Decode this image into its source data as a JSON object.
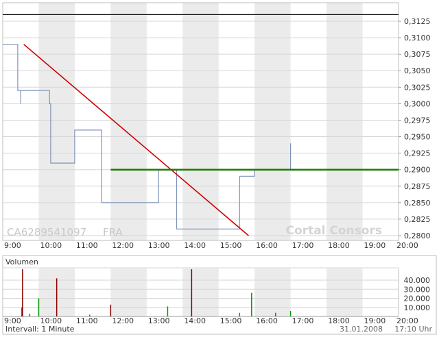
{
  "chart_data": [
    {
      "type": "line",
      "panel": "price",
      "source_id": "CA6289541097",
      "exchange": "FRA",
      "watermark": "Cortal Consors",
      "x_ticks": [
        "9:00",
        "10:00",
        "11:00",
        "12:00",
        "13:00",
        "14:00",
        "15:00",
        "16:00",
        "17:00",
        "18:00",
        "19:00",
        "20:00"
      ],
      "y_ticks": [
        "0,3125",
        "0,3100",
        "0,3075",
        "0,3050",
        "0,3025",
        "0,3000",
        "0,2975",
        "0,2950",
        "0,2925",
        "0,2900",
        "0,2875",
        "0,2850",
        "0,2825",
        "0,2800"
      ],
      "ylim": [
        0.28,
        0.3138
      ],
      "xlim": [
        "09:00",
        "20:00"
      ],
      "grid": "vertical alternating bands + horizontal lines",
      "series": [
        {
          "color": "#7f93b8",
          "style": "step",
          "points": [
            [
              "09:00",
              0.309
            ],
            [
              "09:25",
              0.309
            ],
            [
              "09:25",
              0.302
            ],
            [
              "09:30",
              0.302
            ],
            [
              "09:30",
              0.3
            ],
            [
              "09:30",
              0.302
            ],
            [
              "10:18",
              0.302
            ],
            [
              "10:18",
              0.3
            ],
            [
              "10:20",
              0.3
            ],
            [
              "10:20",
              0.291
            ],
            [
              "11:00",
              0.291
            ],
            [
              "11:00",
              0.296
            ],
            [
              "11:45",
              0.296
            ],
            [
              "11:45",
              0.285
            ],
            [
              "13:20",
              0.285
            ],
            [
              "13:20",
              0.29
            ],
            [
              "13:50",
              0.29
            ],
            [
              "13:50",
              0.281
            ],
            [
              "15:35",
              0.281
            ],
            [
              "15:35",
              0.289
            ],
            [
              "16:00",
              0.289
            ],
            [
              "16:00",
              0.29
            ],
            [
              "17:00",
              0.29
            ],
            [
              "17:00",
              0.294
            ],
            [
              "17:00",
              0.29
            ]
          ]
        },
        {
          "color": "#cc0000",
          "style": "trendline",
          "points": [
            [
              "09:35",
              0.309
            ],
            [
              "15:50",
              0.28
            ]
          ]
        },
        {
          "color": "#1e7a00",
          "style": "trendline",
          "points": [
            [
              "12:00",
              0.29
            ],
            [
              "20:00",
              0.29
            ]
          ]
        },
        {
          "color": "#000000",
          "style": "line",
          "points": [
            [
              "09:00",
              0.3135
            ],
            [
              "20:00",
              0.3135
            ]
          ]
        }
      ]
    },
    {
      "type": "bar",
      "panel": "volume",
      "title": "Volumen",
      "x_ticks": [
        "9:00",
        "10:00",
        "11:00",
        "12:00",
        "13:00",
        "14:00",
        "15:00",
        "16:00",
        "17:00",
        "18:00",
        "19:00",
        "20:00"
      ],
      "y_ticks": [
        "40.000",
        "30.000",
        "20.000",
        "10.000"
      ],
      "ylim": [
        0,
        52000
      ],
      "bars": [
        {
          "time": "09:32",
          "value": 10000,
          "color": "#8b0000"
        },
        {
          "time": "09:33",
          "value": 52000,
          "color": "#8b0000"
        },
        {
          "time": "09:45",
          "value": 3000,
          "color": "#009900"
        },
        {
          "time": "10:00",
          "value": 20000,
          "color": "#009900"
        },
        {
          "time": "10:30",
          "value": 42000,
          "color": "#8b0000"
        },
        {
          "time": "11:25",
          "value": 2000,
          "color": "#009900"
        },
        {
          "time": "12:00",
          "value": 13000,
          "color": "#8b0000"
        },
        {
          "time": "13:35",
          "value": 11000,
          "color": "#009900"
        },
        {
          "time": "14:15",
          "value": 52000,
          "color": "#8b0000"
        },
        {
          "time": "15:35",
          "value": 4000,
          "color": "#009900"
        },
        {
          "time": "15:55",
          "value": 26000,
          "color": "#009900"
        },
        {
          "time": "16:35",
          "value": 4000,
          "color": "#009900"
        },
        {
          "time": "17:00",
          "value": 6000,
          "color": "#009900"
        }
      ]
    }
  ],
  "footer": {
    "interval": "Intervall: 1 Minute",
    "date": "31.01.2008",
    "time": "17:10 Uhr"
  }
}
